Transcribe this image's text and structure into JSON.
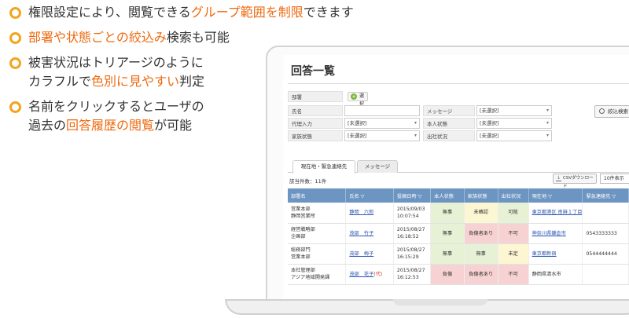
{
  "bullets": [
    {
      "lines": [
        [
          {
            "t": "権限設定により、閲覧できる",
            "em": false
          },
          {
            "t": "グループ範囲を制限",
            "em": true
          },
          {
            "t": "できます",
            "em": false
          }
        ]
      ]
    },
    {
      "lines": [
        [
          {
            "t": "部署や状態ごとの絞込み",
            "em": true
          },
          {
            "t": "検索も可能",
            "em": false
          }
        ]
      ]
    },
    {
      "lines": [
        [
          {
            "t": "被害状況はトリアージのように",
            "em": false
          }
        ],
        [
          {
            "t": "カラフルで",
            "em": false
          },
          {
            "t": "色別に見やすい",
            "em": true
          },
          {
            "t": "判定",
            "em": false
          }
        ]
      ]
    },
    {
      "lines": [
        [
          {
            "t": "名前をクリックするとユーザの",
            "em": false
          }
        ],
        [
          {
            "t": "過去の",
            "em": false
          },
          {
            "t": "回答履歴の閲覧",
            "em": true
          },
          {
            "t": "が可能",
            "em": false
          }
        ]
      ]
    }
  ],
  "accent": "#ee6a10",
  "bullet_ring_color": "#f3a41b",
  "screen": {
    "title": "回答一覧",
    "form": {
      "dept_label": "部署",
      "select_button": "選択",
      "name_label": "氏名",
      "message_label": "メッセージ",
      "message_value": "[未選択]",
      "proxy_label": "代理入力",
      "proxy_value": "[未選択]",
      "self_status_label": "本人状態",
      "self_status_value": "[未選択]",
      "family_status_label": "家族状態",
      "family_status_value": "[未選択]",
      "attendance_label": "出社状況",
      "attendance_value": "[未選択]",
      "search_button": "絞込検索"
    },
    "tabs": [
      {
        "label": "現在地・緊急連絡先",
        "active": true
      },
      {
        "label": "メッセージ",
        "active": false
      }
    ],
    "count_text": "該当件数：11件",
    "csv_button": "CSVダウンロード",
    "per_page": "10件表示",
    "table": {
      "headers": [
        "部署名",
        "氏名 ▽",
        "投稿日時 ▽",
        "本人状態",
        "家族状態",
        "出社状況",
        "現在地 ▽",
        "緊急連絡先 ▽"
      ],
      "rows": [
        {
          "dept": [
            "営業本部",
            "静岡営業所"
          ],
          "name": "静岡　六郎",
          "proxy": "",
          "date": [
            "2015/09/03",
            "10:07:54"
          ],
          "self": "無事",
          "self_c": "g",
          "family": "未確認",
          "family_c": "y",
          "att": "可能",
          "att_c": "g",
          "loc": "東京都港区 南麻１丁目",
          "loc_link": true,
          "tel": ""
        },
        {
          "dept": [
            "経営戦略部",
            "企画部"
          ],
          "name": "茂部　竹子",
          "proxy": "",
          "date": [
            "2015/08/27",
            "16:18:52"
          ],
          "self": "無事",
          "self_c": "g",
          "family": "負傷者あり",
          "family_c": "r",
          "att": "不可",
          "att_c": "r",
          "loc": "神奈川県鎌倉市",
          "loc_link": true,
          "tel": "0543333333"
        },
        {
          "dept": [
            "総務部門",
            "営業本部"
          ],
          "name": "茂部　梅子",
          "proxy": "",
          "date": [
            "2015/08/27",
            "16:15:29"
          ],
          "self": "無事",
          "self_c": "g",
          "family": "無事",
          "family_c": "g",
          "att": "未定",
          "att_c": "y",
          "loc": "東京都新宿",
          "loc_link": true,
          "tel": "0544444444"
        },
        {
          "dept": [
            "本社管理部",
            "アジア地域開発課"
          ],
          "name": "茂部　花子",
          "proxy": "(代)",
          "date": [
            "2015/08/27",
            "16:12:53"
          ],
          "self": "負傷",
          "self_c": "r",
          "family": "負傷者あり",
          "family_c": "r",
          "att": "不可",
          "att_c": "r",
          "loc": "静岡県清水市",
          "loc_link": false,
          "tel": ""
        }
      ]
    }
  }
}
